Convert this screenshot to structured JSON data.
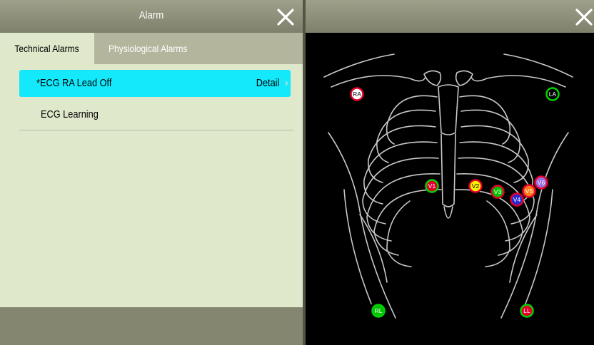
{
  "alarm_panel": {
    "title": "Alarm",
    "close_icon": "close-icon",
    "tabs": [
      {
        "label": "Technical Alarms",
        "selected": true
      },
      {
        "label": "Physiological Alarms",
        "selected": false
      }
    ],
    "alarms": [
      {
        "text": "*ECG RA Lead Off",
        "detail": "Detail",
        "highlighted": true
      },
      {
        "text": "ECG Learning"
      }
    ],
    "highlight_color": "#13e9fb"
  },
  "electrode_panel": {
    "close_icon": "close-icon",
    "electrodes": [
      {
        "label": "RA",
        "fill": "#ffffff",
        "ring": "#e4002b",
        "text": "#000000"
      },
      {
        "label": "LA",
        "fill": "#000000",
        "ring": "#00d400",
        "text": "#ffffff"
      },
      {
        "label": "V1",
        "fill": "#e4002b",
        "ring": "#00d400",
        "text": "#ffffff"
      },
      {
        "label": "V2",
        "fill": "#fff200",
        "ring": "#e4002b",
        "text": "#000000"
      },
      {
        "label": "V3",
        "fill": "#00c000",
        "ring": "#e4002b",
        "text": "#ffffff"
      },
      {
        "label": "V4",
        "fill": "#2a2ad0",
        "ring": "#e4002b",
        "text": "#ffffff"
      },
      {
        "label": "V5",
        "fill": "#ff7a1a",
        "ring": "#e4002b",
        "text": "#ffffff"
      },
      {
        "label": "V6",
        "fill": "#9b6fe0",
        "ring": "#e4002b",
        "text": "#ffffff"
      },
      {
        "label": "RL",
        "fill": "#00c000",
        "ring": "#00d400",
        "text": "#ffffff"
      },
      {
        "label": "LL",
        "fill": "#e4002b",
        "ring": "#00d400",
        "text": "#ffffff"
      }
    ]
  }
}
